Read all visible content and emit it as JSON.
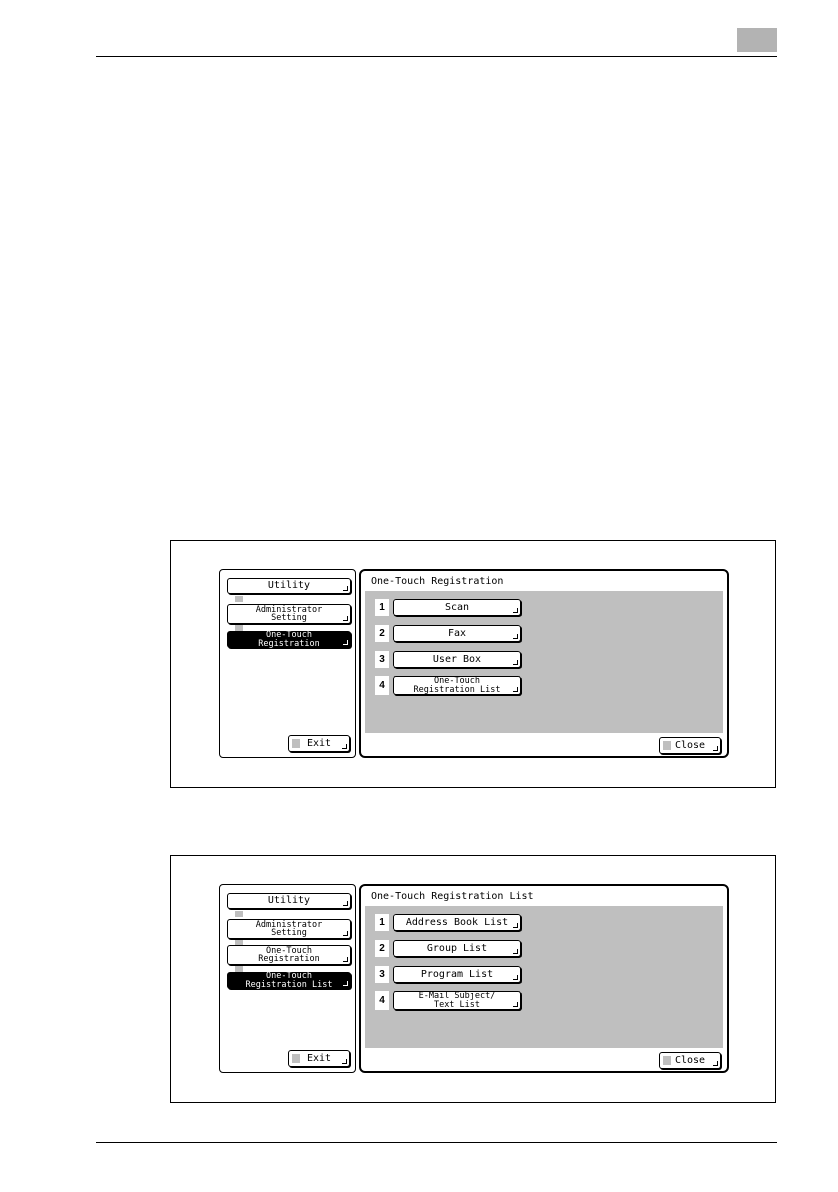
{
  "figures": [
    {
      "left_pane": {
        "items": [
          {
            "label": "Utility"
          },
          {
            "label": "Administrator\nSetting"
          },
          {
            "label": "One-Touch\nRegistration"
          }
        ],
        "exit_label": "Exit"
      },
      "right_pane": {
        "title": "One-Touch Registration",
        "options": [
          {
            "number": "1",
            "label": "Scan"
          },
          {
            "number": "2",
            "label": "Fax"
          },
          {
            "number": "3",
            "label": "User Box"
          },
          {
            "number": "4",
            "label": "One-Touch\nRegistration List"
          }
        ],
        "close_label": "Close"
      }
    },
    {
      "left_pane": {
        "items": [
          {
            "label": "Utility"
          },
          {
            "label": "Administrator\nSetting"
          },
          {
            "label": "One-Touch\nRegistration"
          },
          {
            "label": "One-Touch\nRegistration List"
          }
        ],
        "exit_label": "Exit"
      },
      "right_pane": {
        "title": "One-Touch Registration List",
        "options": [
          {
            "number": "1",
            "label": "Address Book List"
          },
          {
            "number": "2",
            "label": "Group List"
          },
          {
            "number": "3",
            "label": "Program List"
          },
          {
            "number": "4",
            "label": "E-Mail Subject/\nText List"
          }
        ],
        "close_label": "Close"
      }
    }
  ]
}
